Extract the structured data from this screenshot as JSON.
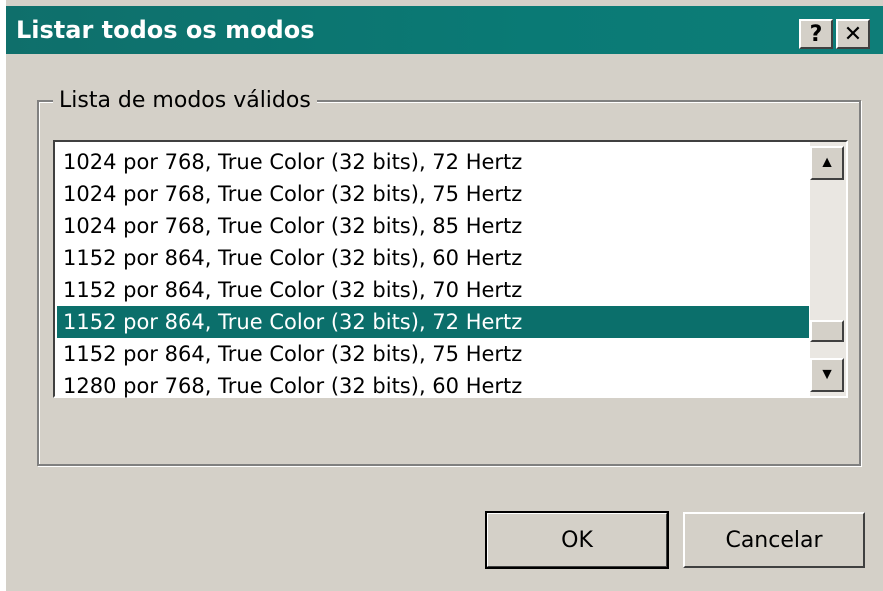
{
  "window": {
    "title": "Listar todos os modos",
    "help_label": "?",
    "close_label": "✕"
  },
  "group": {
    "label": "Lista de modos válidos"
  },
  "modes": [
    "1024 por 768, True Color (32 bits), 72 Hertz",
    "1024 por 768, True Color (32 bits), 75 Hertz",
    "1024 por 768, True Color (32 bits), 85 Hertz",
    "1152 por 864, True Color (32 bits), 60 Hertz",
    "1152 por 864, True Color (32 bits), 70 Hertz",
    "1152 por 864, True Color (32 bits), 72 Hertz",
    "1152 por 864, True Color (32 bits), 75 Hertz",
    "1280 por 768, True Color (32 bits), 60 Hertz"
  ],
  "selected_index": 5,
  "scrollbar": {
    "up_icon": "scroll-up-arrow-icon",
    "down_icon": "scroll-down-arrow-icon"
  },
  "buttons": {
    "ok_label": "OK",
    "cancel_label": "Cancelar"
  },
  "colors": {
    "titlebar": "#0b6f6b",
    "selection": "#0b6f6b",
    "face": "#d4d0c8"
  }
}
